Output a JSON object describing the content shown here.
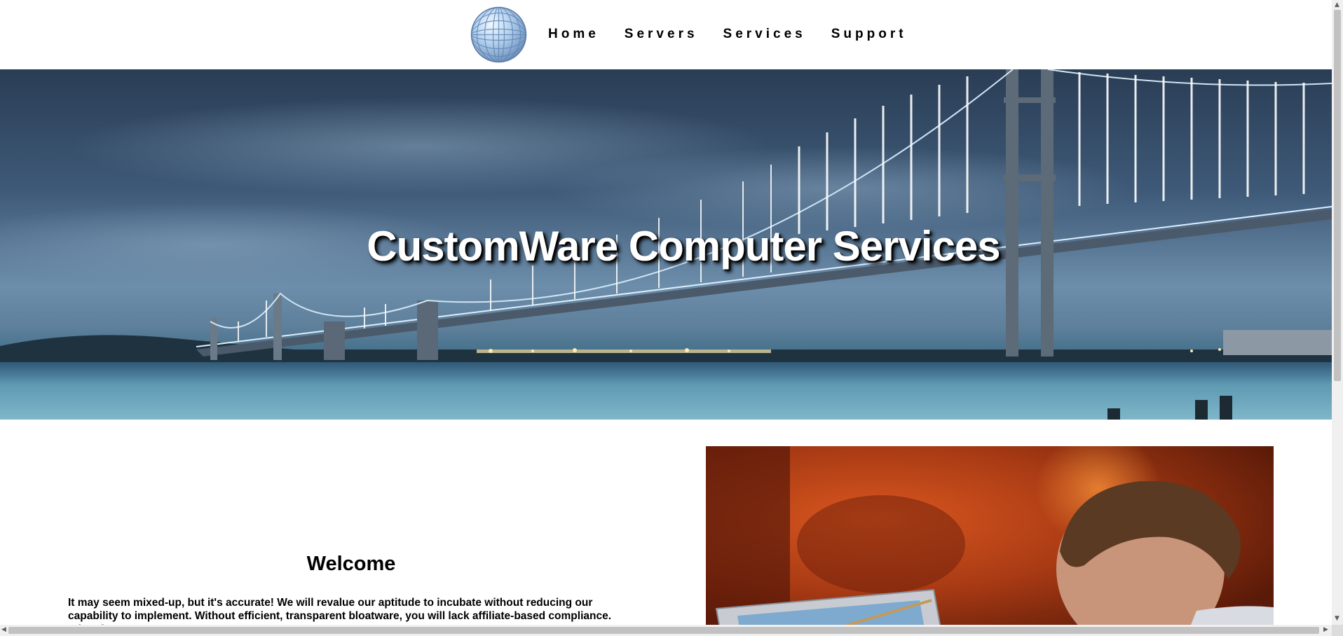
{
  "site": {
    "logo_icon": "globe-logo-icon"
  },
  "nav": {
    "items": [
      {
        "label": "Home"
      },
      {
        "label": "Servers"
      },
      {
        "label": "Services"
      },
      {
        "label": "Support"
      }
    ]
  },
  "hero": {
    "title": "CustomWare Computer Services"
  },
  "main": {
    "welcome_title": "Welcome",
    "welcome_text": "It may seem mixed-up, but it's accurate! We will revalue our aptitude to incubate without reducing our capability to implement. Without efficient, transparent bloatware, you will lack affiliate-based compliance. What do we"
  },
  "colors": {
    "nav_text": "#000000",
    "hero_text": "#ffffff",
    "background": "#ffffff"
  }
}
